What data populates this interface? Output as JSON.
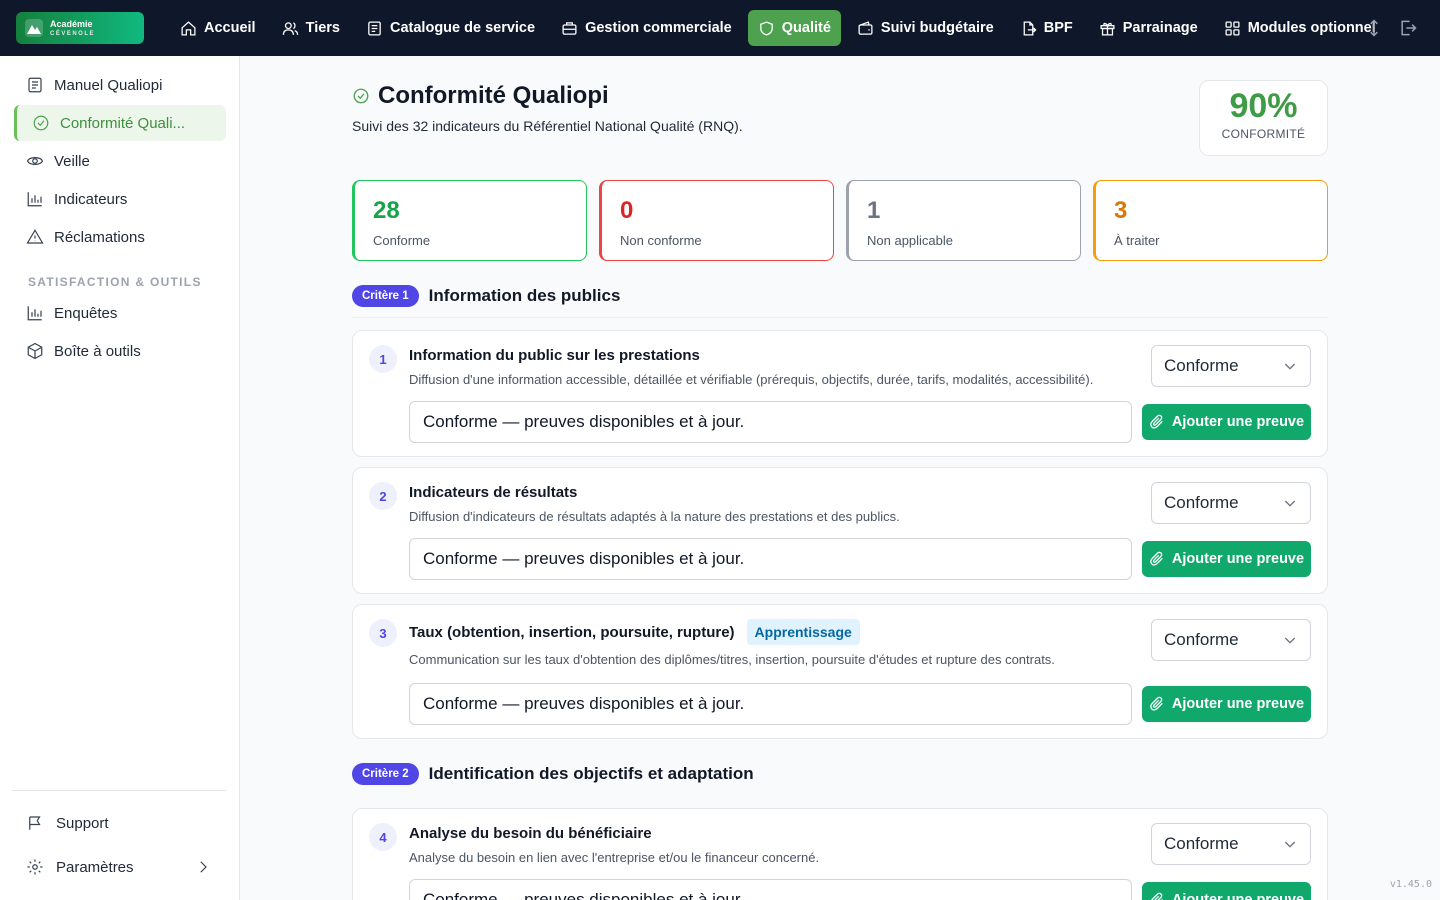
{
  "brand": {
    "line1": "Académie",
    "line2": "CÉVENOLE"
  },
  "nav": {
    "items": [
      {
        "label": "Accueil",
        "icon": "home-icon"
      },
      {
        "label": "Tiers",
        "icon": "users-icon"
      },
      {
        "label": "Catalogue de service",
        "icon": "catalog-icon"
      },
      {
        "label": "Gestion commerciale",
        "icon": "briefcase-icon"
      },
      {
        "label": "Qualité",
        "icon": "shield-icon",
        "active": true
      },
      {
        "label": "Suivi budgétaire",
        "icon": "wallet-icon"
      },
      {
        "label": "BPF",
        "icon": "file-export-icon"
      },
      {
        "label": "Parrainage",
        "icon": "gift-icon"
      },
      {
        "label": "Modules optionnel",
        "icon": "grid-icon"
      }
    ]
  },
  "sidebar": {
    "items": [
      {
        "label": "Manuel Qualiopi",
        "icon": "book-icon"
      },
      {
        "label": "Conformité Quali...",
        "icon": "check-circle-icon",
        "active": true
      },
      {
        "label": "Veille",
        "icon": "eye-icon"
      },
      {
        "label": "Indicateurs",
        "icon": "bar-chart-icon"
      },
      {
        "label": "Réclamations",
        "icon": "warning-icon"
      }
    ],
    "section_label": "SATISFACTION & OUTILS",
    "section_items": [
      {
        "label": "Enquêtes",
        "icon": "bar-chart-icon"
      },
      {
        "label": "Boîte à outils",
        "icon": "box-icon"
      }
    ],
    "support_label": "Support",
    "settings_label": "Paramètres"
  },
  "page": {
    "title": "Conformité Qualiopi",
    "subtitle": "Suivi des 32 indicateurs du Référentiel National Qualité (RNQ).",
    "score_value": "90%",
    "score_label": "CONFORMITÉ"
  },
  "stats": [
    {
      "value": "28",
      "label": "Conforme",
      "color": "#16a34a",
      "border": "#22c55e"
    },
    {
      "value": "0",
      "label": "Non conforme",
      "color": "#dc2626",
      "border": "#ef4444"
    },
    {
      "value": "1",
      "label": "Non applicable",
      "color": "#6b7280",
      "border": "#9ca3af"
    },
    {
      "value": "3",
      "label": "À traiter",
      "color": "#d97706",
      "border": "#f59e0b"
    }
  ],
  "criteria": [
    {
      "badge": "Critère 1",
      "title": "Information des publics"
    },
    {
      "badge": "Critère 2",
      "title": "Identification des objectifs et adaptation"
    }
  ],
  "indicators": [
    {
      "num": "1",
      "title": "Information du public sur les prestations",
      "tag": "",
      "desc": "Diffusion d'une information accessible, détaillée et vérifiable (prérequis, objectifs, durée, tarifs, modalités, accessibilité).",
      "status": "Conforme",
      "comment": "Conforme — preuves disponibles et à jour.",
      "button": "Ajouter une preuve"
    },
    {
      "num": "2",
      "title": "Indicateurs de résultats",
      "tag": "",
      "desc": "Diffusion d'indicateurs de résultats adaptés à la nature des prestations et des publics.",
      "status": "Conforme",
      "comment": "Conforme — preuves disponibles et à jour.",
      "button": "Ajouter une preuve"
    },
    {
      "num": "3",
      "title": "Taux (obtention, insertion, poursuite, rupture)",
      "tag": "Apprentissage",
      "desc": "Communication sur les taux d'obtention des diplômes/titres, insertion, poursuite d'études et rupture des contrats.",
      "status": "Conforme",
      "comment": "Conforme — preuves disponibles et à jour.",
      "button": "Ajouter une preuve"
    },
    {
      "num": "4",
      "title": "Analyse du besoin du bénéficiaire",
      "tag": "",
      "desc": "Analyse du besoin en lien avec l'entreprise et/ou le financeur concerné.",
      "status": "Conforme",
      "comment": "Conforme — preuves disponibles et à jour.",
      "button": "Ajouter une preuve"
    }
  ],
  "version": "v1.45.0"
}
